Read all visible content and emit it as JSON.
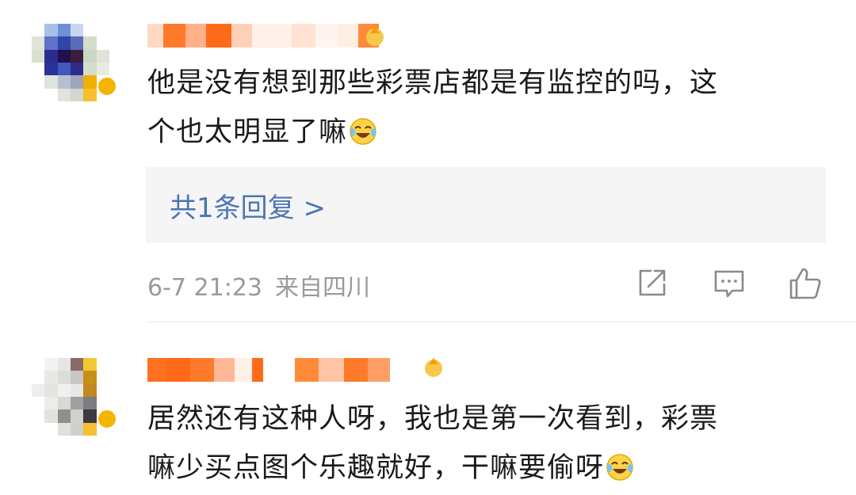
{
  "comments": [
    {
      "text_line1": "他是没有想到那些彩票店都是有监控的吗，这",
      "text_line2": "个也太明显了嘛",
      "emoji_icon": "laugh-cry-emoji-icon",
      "reply_link": "共1条回复 >",
      "timestamp": "6-7 21:23",
      "location": "来自四川",
      "actions": [
        "share-icon",
        "comment-icon",
        "like-icon"
      ]
    },
    {
      "text_line1": "居然还有这种人呀，我也是第一次看到，彩票",
      "text_line2": "嘛少买点图个乐趣就好，干嘛要偷呀",
      "emoji_icon": "laugh-cry-emoji-icon"
    }
  ],
  "colors": {
    "text": "#1a1a1a",
    "meta": "#9a9a9a",
    "link": "#4a75b5",
    "reply_bg": "#f5f5f5",
    "username_blur": "#ff6a1a"
  }
}
